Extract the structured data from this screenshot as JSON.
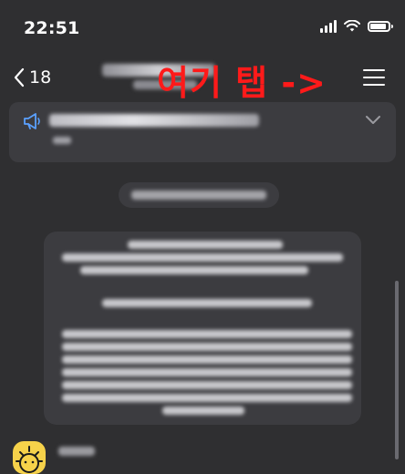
{
  "status_bar": {
    "time": "22:51"
  },
  "nav": {
    "back_count": "18",
    "annotation_text": "여기 탭 ->"
  },
  "colors": {
    "background": "#2f2f31",
    "surface": "#3c3c40",
    "annotation": "#ff1a1a",
    "megaphone": "#5aa0ff",
    "avatar": "#f6d24a"
  },
  "icons": {
    "back": "chevron-left-icon",
    "menu": "hamburger-menu-icon",
    "notice": "megaphone-icon",
    "expand": "chevron-down-icon",
    "wifi": "wifi-icon",
    "battery": "battery-icon"
  }
}
